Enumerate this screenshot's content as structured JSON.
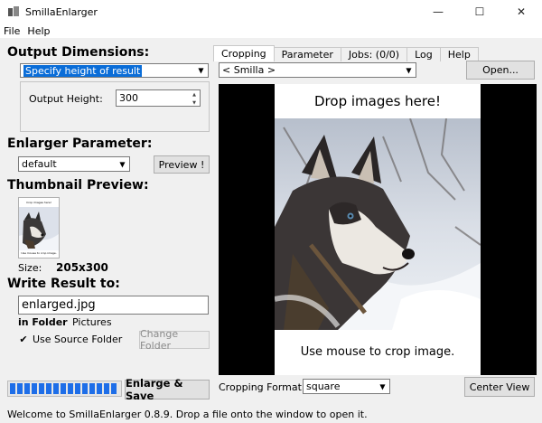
{
  "window": {
    "title": "SmillaEnlarger",
    "minimize": "—",
    "maximize": "☐",
    "close": "✕"
  },
  "menu": [
    "File",
    "Help"
  ],
  "left": {
    "output_dimensions_title": "Output Dimensions:",
    "dimension_mode": "Specify height of result",
    "output_height_label": "Output Height:",
    "output_height_value": "300",
    "enlarger_parameter_title": "Enlarger Parameter:",
    "preset": "default",
    "preview_button": "Preview !",
    "thumbnail_title": "Thumbnail Preview:",
    "thumb_top_text": "Crop images here!",
    "thumb_bottom_text": "Use mouse to crop image.",
    "size_label": "Size:",
    "size_value": "205x300",
    "write_result_title": "Write Result to:",
    "filename": "enlarged.jpg",
    "in_folder_label": "in Folder",
    "folder_name": "Pictures",
    "use_source_folder_label": "Use Source Folder",
    "use_source_folder_checked": true,
    "change_folder_button": "Change Folder",
    "enlarge_save_button": "Enlarge & Save",
    "progress_percent": 100
  },
  "right": {
    "tabs": [
      {
        "label": "Cropping",
        "active": true
      },
      {
        "label": "Parameter",
        "active": false
      },
      {
        "label": "Jobs: (0/0)",
        "active": false
      },
      {
        "label": "Log",
        "active": false
      },
      {
        "label": "Help",
        "active": false
      }
    ],
    "source_select": "< Smilla >",
    "open_button": "Open...",
    "drop_text": "Drop images here!",
    "crop_text": "Use mouse to crop image.",
    "cropping_format_label": "Cropping Format:",
    "cropping_format_value": "square",
    "center_view_button": "Center View"
  },
  "status": "Welcome to SmillaEnlarger 0.8.9.  Drop a file onto the window to open it."
}
